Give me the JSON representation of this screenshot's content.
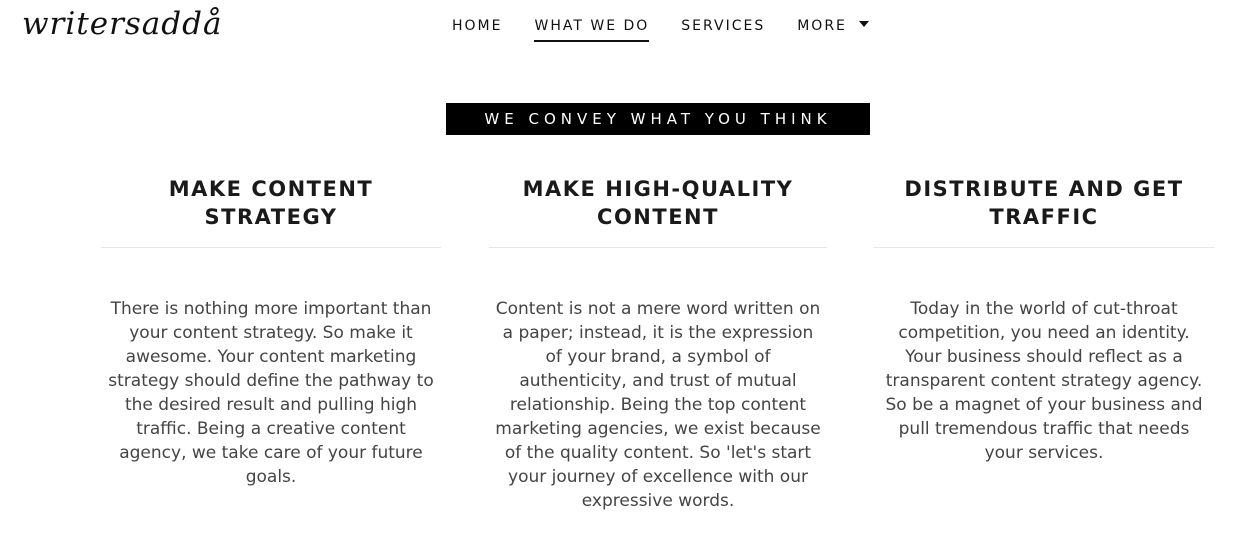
{
  "header": {
    "logo_text": "writersaddå",
    "nav": [
      {
        "label": "HOME"
      },
      {
        "label": "WHAT WE DO"
      },
      {
        "label": "SERVICES"
      },
      {
        "label": "MORE"
      }
    ]
  },
  "tagline": "WE CONVEY WHAT YOU THINK",
  "columns": [
    {
      "title": "MAKE CONTENT STRATEGY",
      "text": "There is nothing more important than your content strategy. So make it awesome. Your content marketing strategy should define the pathway to the desired result and pulling high traffic. Being a creative content agency, we take care of your future goals."
    },
    {
      "title": "MAKE HIGH-QUALITY CONTENT",
      "text": "Content is not a mere word written on a paper; instead, it is the expression of your brand, a symbol of authenticity, and trust of mutual relationship. Being the top content marketing agencies, we exist because of the quality content. So 'let's start your journey of excellence with our expressive words."
    },
    {
      "title": "DISTRIBUTE AND GET TRAFFIC",
      "text": "Today in the world of cut-throat competition, you need an identity. Your business should reflect as a transparent content strategy agency. So be a magnet of your business and pull tremendous traffic that needs your services."
    }
  ]
}
